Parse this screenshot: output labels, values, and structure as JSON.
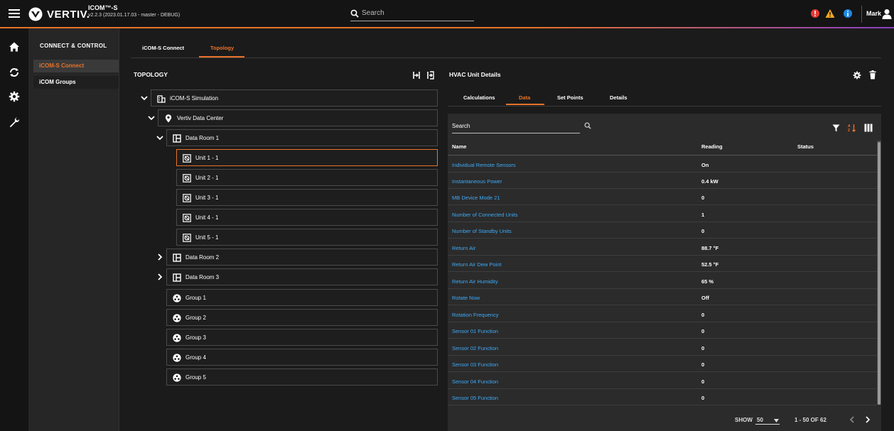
{
  "topbar": {
    "brand": "VERTIV.",
    "app_name": "ICOM™-S",
    "app_version": "v2.2.3 (2023.01.17.03 - master - DEBUG)",
    "search_placeholder": "Search",
    "user_name": "Mark",
    "alert_colors": {
      "error": "#e53935",
      "warning": "#f5a623",
      "info": "#1e88e5"
    }
  },
  "rail": {
    "icons": [
      "home-icon",
      "connect-icon",
      "settings-icon",
      "wrench-icon"
    ]
  },
  "nav": {
    "title": "CONNECT & CONTROL",
    "items": [
      {
        "label": "iCOM-S Connect",
        "active": true
      },
      {
        "label": "iCOM Groups",
        "active": false
      }
    ]
  },
  "tabs": {
    "main": [
      {
        "label": "iCOM-S Connect",
        "active": false
      },
      {
        "label": "Topology",
        "active": true
      }
    ]
  },
  "topology": {
    "title": "TOPOLOGY",
    "nodes": [
      {
        "label": "iCOM-S Simulation",
        "icon": "building-icon"
      },
      {
        "label": "Vertiv Data Center",
        "icon": "location-pin-icon"
      },
      {
        "label": "Data Room 1",
        "icon": "room-icon"
      },
      {
        "label": "Unit 1 - 1",
        "icon": "unit-icon"
      },
      {
        "label": "Unit 2 - 1",
        "icon": "unit-icon"
      },
      {
        "label": "Unit 3 - 1",
        "icon": "unit-icon"
      },
      {
        "label": "Unit 4 - 1",
        "icon": "unit-icon"
      },
      {
        "label": "Unit 5 - 1",
        "icon": "unit-icon"
      },
      {
        "label": "Data Room 2",
        "icon": "room-icon"
      },
      {
        "label": "Data Room 3",
        "icon": "room-icon"
      },
      {
        "label": "Group 1",
        "icon": "group-icon"
      },
      {
        "label": "Group 2",
        "icon": "group-icon"
      },
      {
        "label": "Group 3",
        "icon": "group-icon"
      },
      {
        "label": "Group 4",
        "icon": "group-icon"
      },
      {
        "label": "Group 5",
        "icon": "group-icon"
      }
    ]
  },
  "details": {
    "title": "HVAC Unit Details",
    "tabs": [
      {
        "label": "Calculations",
        "active": false
      },
      {
        "label": "Data",
        "active": true
      },
      {
        "label": "Set Points",
        "active": false
      },
      {
        "label": "Details",
        "active": false
      }
    ],
    "search_placeholder": "Search",
    "columns": {
      "name": "Name",
      "reading": "Reading",
      "status": "Status"
    },
    "rows": [
      {
        "name": "Individual Remote Sensors",
        "reading": "On",
        "status": ""
      },
      {
        "name": "Instantaneous Power",
        "reading": "0.4 kW",
        "status": ""
      },
      {
        "name": "MB Device Mode 21",
        "reading": "0",
        "status": ""
      },
      {
        "name": "Number of Connected Units",
        "reading": "1",
        "status": ""
      },
      {
        "name": "Number of Standby Units",
        "reading": "0",
        "status": ""
      },
      {
        "name": "Return Air",
        "reading": "88.7 °F",
        "status": ""
      },
      {
        "name": "Return Air Dew Point",
        "reading": "52.5 °F",
        "status": ""
      },
      {
        "name": "Return Air Humidity",
        "reading": "65 %",
        "status": ""
      },
      {
        "name": "Rotate Now",
        "reading": "Off",
        "status": ""
      },
      {
        "name": "Rotation Frequency",
        "reading": "0",
        "status": ""
      },
      {
        "name": "Sensor 01 Function",
        "reading": "0",
        "status": ""
      },
      {
        "name": "Sensor 02 Function",
        "reading": "0",
        "status": ""
      },
      {
        "name": "Sensor 03 Function",
        "reading": "0",
        "status": ""
      },
      {
        "name": "Sensor 04 Function",
        "reading": "0",
        "status": ""
      },
      {
        "name": "Sensor 05 Function",
        "reading": "0",
        "status": ""
      }
    ],
    "footer": {
      "show_label": "SHOW",
      "page_size": "50",
      "range": "1 - 50 OF 62"
    }
  },
  "colors": {
    "accent": "#e8722a",
    "link": "#3fa9f5"
  }
}
